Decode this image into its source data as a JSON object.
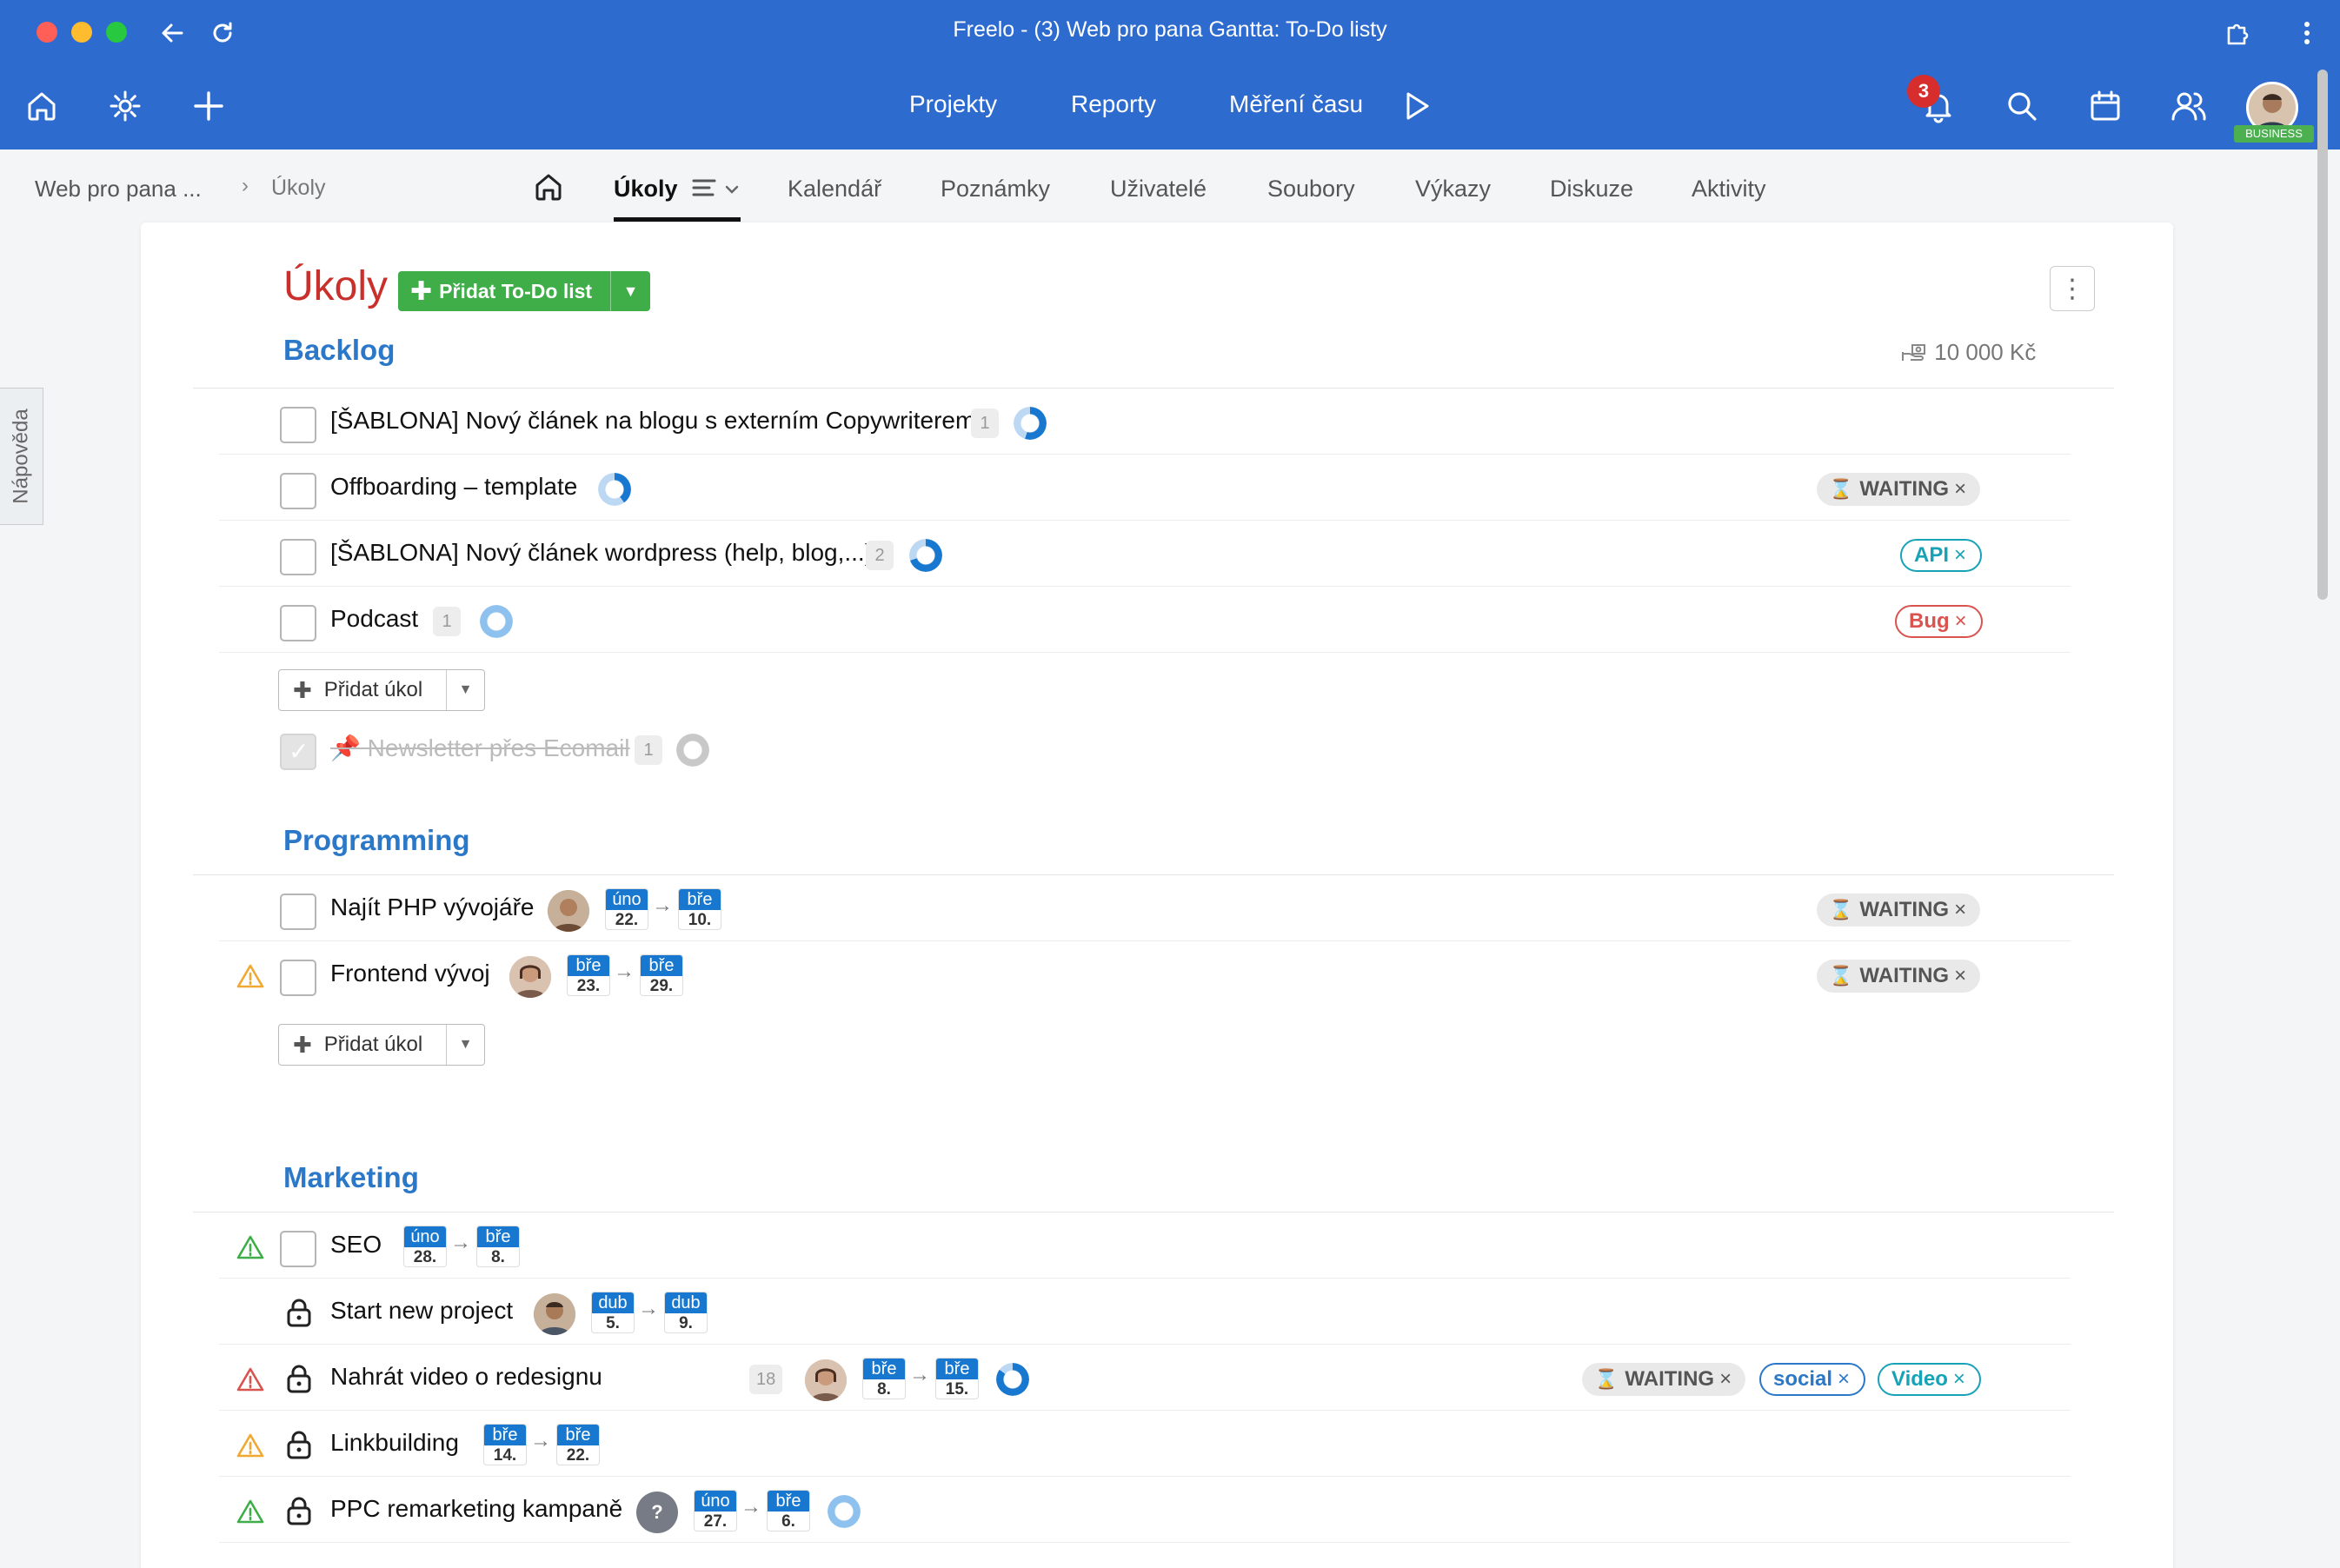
{
  "window": {
    "title": "Freelo - (3) Web pro pana Gantta: To-Do listy"
  },
  "nav": {
    "links": [
      "Projekty",
      "Reporty",
      "Měření času"
    ],
    "notifications": "3",
    "plan_badge": "BUSINESS"
  },
  "breadcrumb": {
    "project": "Web pro pana ...",
    "current": "Úkoly"
  },
  "tabs": [
    "Úkoly",
    "Kalendář",
    "Poznámky",
    "Uživatelé",
    "Soubory",
    "Výkazy",
    "Diskuze",
    "Aktivity"
  ],
  "help_tab": "Nápověda",
  "page": {
    "title": "Úkoly",
    "add_list_label": "Přidat To-Do list",
    "budget": "10 000 Kč",
    "add_task_label": "Přidat úkol"
  },
  "sections": [
    {
      "title": "Backlog",
      "tasks": [
        {
          "name": "[ŠABLONA] Nový článek na blogu s externím Copywriterem",
          "count": "1"
        },
        {
          "name": "Offboarding – template",
          "tag": "WAITING"
        },
        {
          "name": "[ŠABLONA] Nový článek wordpress (help, blog,...)",
          "count": "2",
          "tag": "API"
        },
        {
          "name": "Podcast",
          "count": "1",
          "tag": "Bug"
        },
        {
          "name": "Newsletter přes Ecomail",
          "count": "1",
          "done": true
        }
      ]
    },
    {
      "title": "Programming",
      "tasks": [
        {
          "name": "Najít PHP vývojáře",
          "from": {
            "mon": "úno",
            "day": "22."
          },
          "to": {
            "mon": "bře",
            "day": "10."
          },
          "tag": "WAITING"
        },
        {
          "name": "Frontend vývoj",
          "from": {
            "mon": "bře",
            "day": "23."
          },
          "to": {
            "mon": "bře",
            "day": "29."
          },
          "tag": "WAITING"
        }
      ]
    },
    {
      "title": "Marketing",
      "tasks": [
        {
          "name": "SEO",
          "from": {
            "mon": "úno",
            "day": "28."
          },
          "to": {
            "mon": "bře",
            "day": "8."
          }
        },
        {
          "name": "Start new project",
          "from": {
            "mon": "dub",
            "day": "5."
          },
          "to": {
            "mon": "dub",
            "day": "9."
          }
        },
        {
          "name": "Nahrát video o redesignu",
          "count": "18",
          "from": {
            "mon": "bře",
            "day": "8."
          },
          "to": {
            "mon": "bře",
            "day": "15."
          },
          "tags": [
            "WAITING",
            "social",
            "Video"
          ]
        },
        {
          "name": "Linkbuilding",
          "from": {
            "mon": "bře",
            "day": "14."
          },
          "to": {
            "mon": "bře",
            "day": "22."
          }
        },
        {
          "name": "PPC remarketing kampaně",
          "unknown_user": "?",
          "from": {
            "mon": "úno",
            "day": "27."
          },
          "to": {
            "mon": "bře",
            "day": "6."
          }
        }
      ]
    }
  ],
  "colors": {
    "brand_blue": "#2d6bcf",
    "title_red": "#c9302c",
    "section_blue": "#2b78c8",
    "add_green": "#3fae49",
    "date_blue": "#1878d0"
  }
}
